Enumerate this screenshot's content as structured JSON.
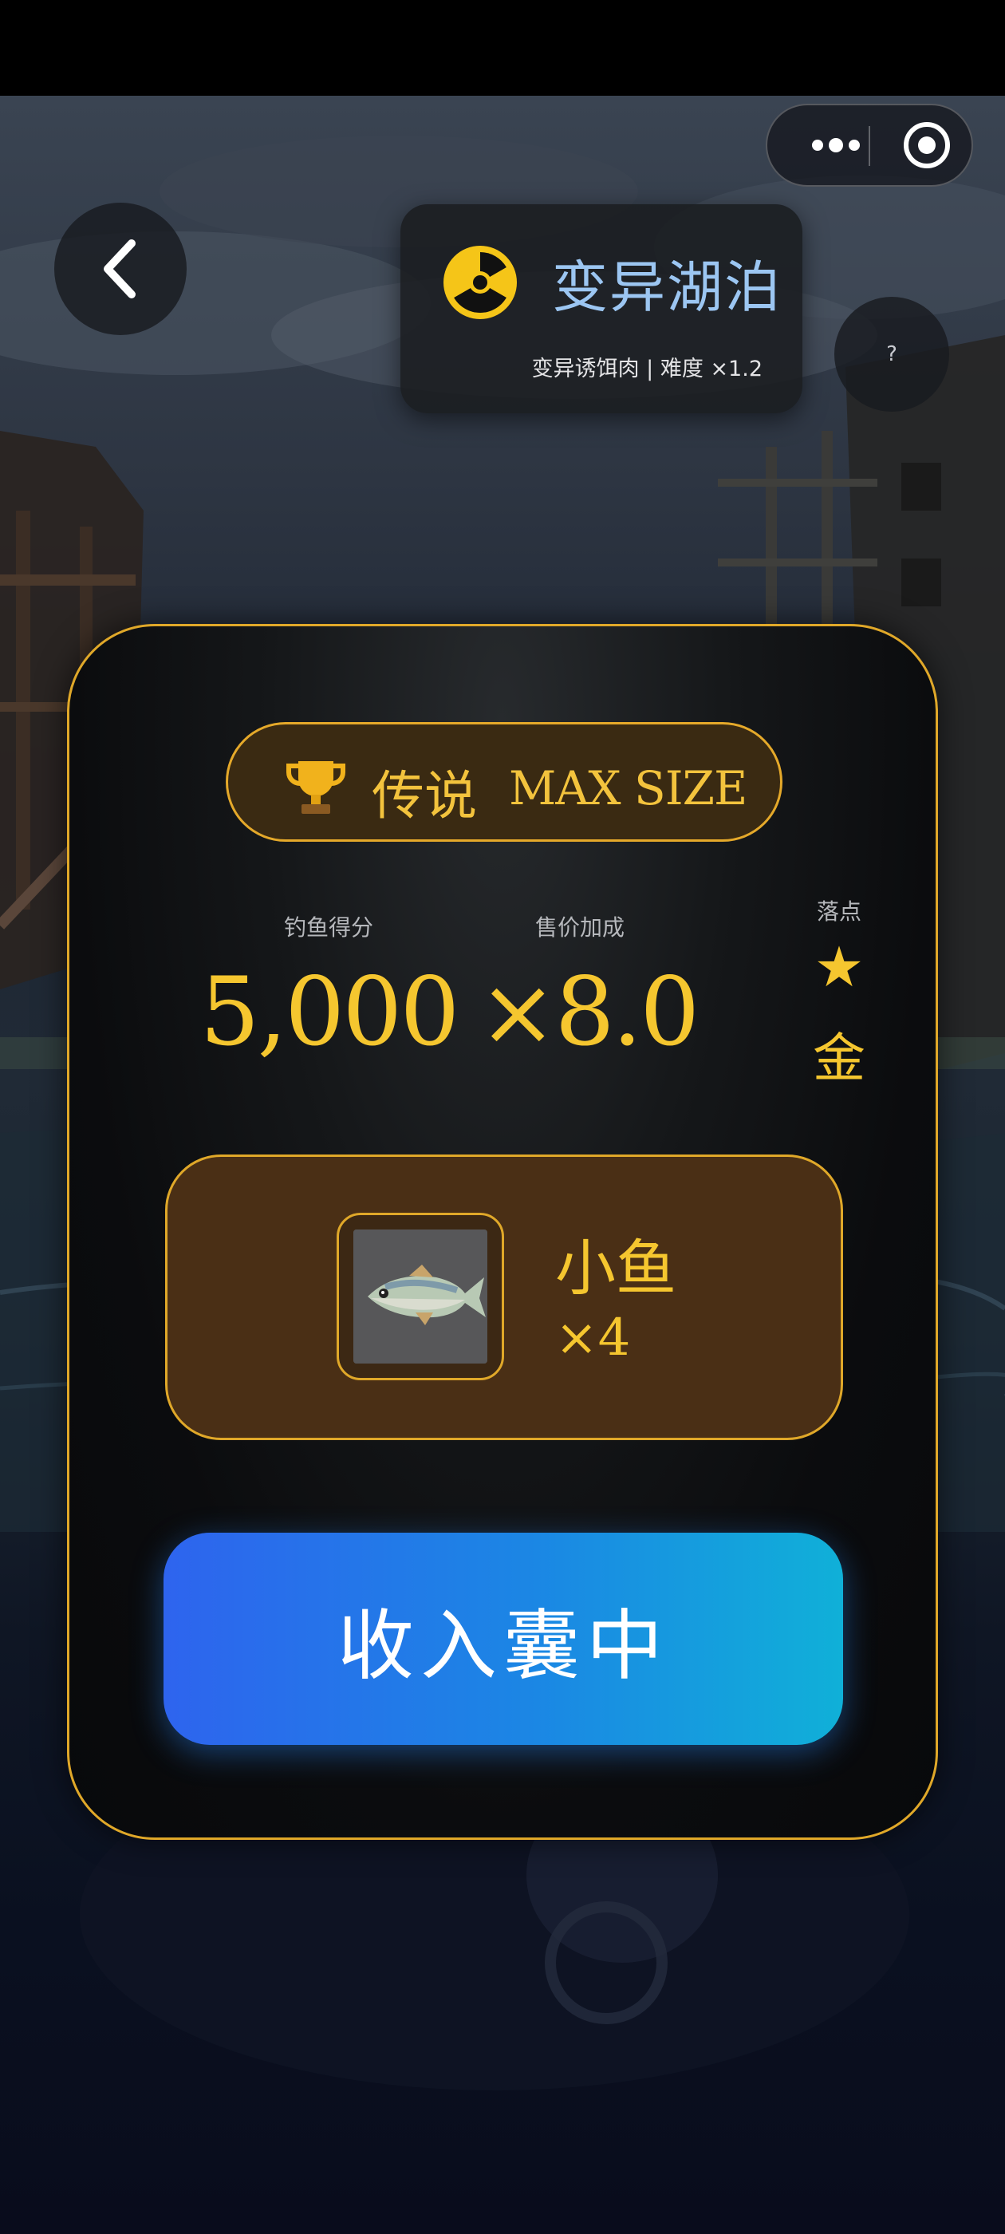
{
  "topbar": {
    "menu_icon": "more-dots-icon",
    "close_icon": "target-circle-icon"
  },
  "nav": {
    "back_icon": "chevron-left-icon",
    "help_label": "?"
  },
  "location": {
    "icon": "radiation-hazard-icon",
    "title": "变异湖泊",
    "subtitle": "变异诱饵肉 | 难度 ×1.2"
  },
  "result": {
    "rarity_icon": "trophy-icon",
    "rarity_label": "传说",
    "size_label": "MAX SIZE",
    "score_label": "钓鱼得分",
    "score_value": "5,000",
    "multiplier_label": "售价加成",
    "multiplier_value": "×8.0",
    "drop_label": "落点",
    "drop_star": "★",
    "drop_tier": "金",
    "catch": {
      "image_icon": "fish-icon",
      "name": "小鱼",
      "count": "×4"
    },
    "collect_label": "收入囊中"
  },
  "colors": {
    "accent_gold": "#f5c62f",
    "panel_border": "#e0a829",
    "button_gradient_start": "#2e64ee",
    "button_gradient_end": "#10b0d8",
    "location_title": "#9cc6f2"
  }
}
